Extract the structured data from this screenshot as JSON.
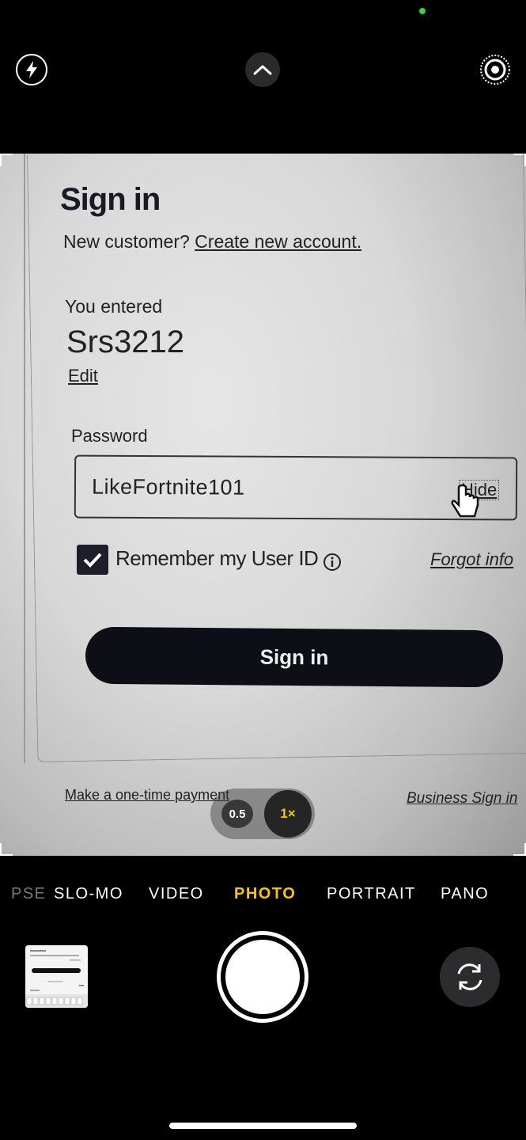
{
  "camera_top": {
    "flash_icon": "lightning-bolt-icon",
    "expand_icon": "chevron-up-icon",
    "live_icon": "live-photo-icon"
  },
  "viewfinder": {
    "signin_title": "Sign in",
    "new_customer_text": "New customer?",
    "create_account_link": "Create new account.",
    "you_entered_label": "You entered",
    "username": "Srs3212",
    "edit_link": "Edit",
    "password_label": "Password",
    "password_value": "LikeFortnite101",
    "hide_link": "Hide",
    "remember_label": "Remember my User ID",
    "forgot_link": "Forgot info",
    "signin_button": "Sign in",
    "onetime_payment_link": "Make a one-time payment",
    "business_signin_link": "Business Sign in"
  },
  "zoom": {
    "options": [
      "0.5",
      "1×"
    ],
    "selected": "1×"
  },
  "modes": {
    "items": [
      "PSE",
      "SLO-MO",
      "VIDEO",
      "PHOTO",
      "PORTRAIT",
      "PANO"
    ],
    "active": "PHOTO"
  },
  "colors": {
    "accent": "#f5c518",
    "status_dot": "#3ecf4e"
  }
}
